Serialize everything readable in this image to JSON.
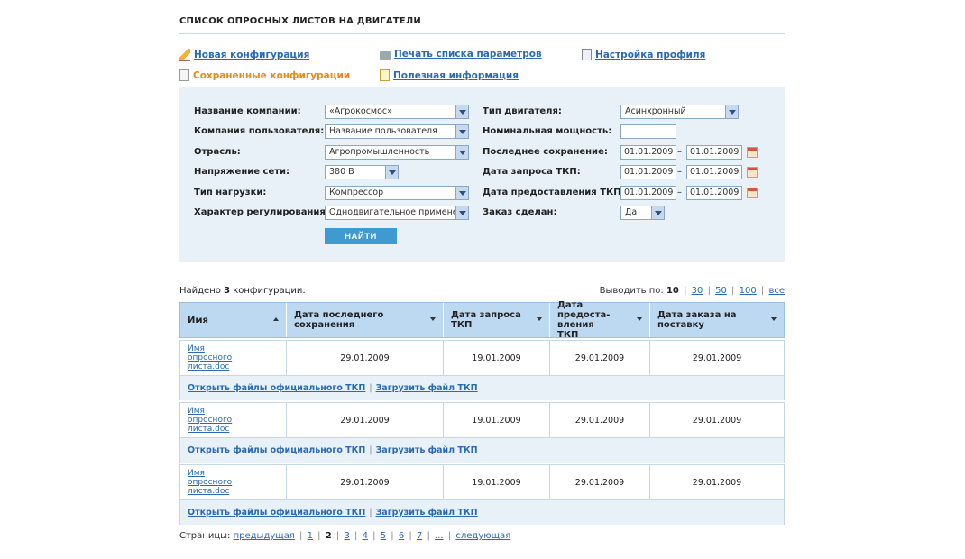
{
  "page_title": "СПИСОК ОПРОСНЫХ ЛИСТОВ НА ДВИГАТЕЛИ",
  "nav": {
    "new_config": "Новая конфигурация",
    "print_params": "Печать списка параметров",
    "profile_settings": "Настройка профиля",
    "saved_configs": "Сохраненные конфигурации",
    "useful_info": "Полезная информация"
  },
  "filters": {
    "company_name_label": "Название компании:",
    "company_name_value": "«Агрокосмос»",
    "user_company_label": "Компания пользователя:",
    "user_company_value": "Название пользователя",
    "industry_label": "Отрасль:",
    "industry_value": "Агропромышленность",
    "voltage_label": "Напряжение сети:",
    "voltage_value": "380 В",
    "load_type_label": "Тип нагрузки:",
    "load_type_value": "Компрессор",
    "regulation_label": "Характер регулирования:",
    "regulation_value": "Однодвигательное применен",
    "engine_type_label": "Тип двигателя:",
    "engine_type_value": "Асинхронный",
    "rated_power_label": "Номинальная мощность:",
    "rated_power_value": "",
    "last_save_label": "Последнее сохранение:",
    "last_save_from": "01.01.2009",
    "last_save_to": "01.01.2009",
    "tkp_request_label": "Дата запроса ТКП:",
    "tkp_request_from": "01.01.2009",
    "tkp_request_to": "01.01.2009",
    "tkp_provide_label": "Дата предоставления ТКП:",
    "tkp_provide_from": "01.01.2009",
    "tkp_provide_to": "01.01.2009",
    "order_made_label": "Заказ сделан:",
    "order_made_value": "Да",
    "dash": "–",
    "search_button": "НАЙТИ"
  },
  "results": {
    "found_prefix": "Найдено",
    "found_count": "3",
    "found_suffix": "конфигурации:",
    "per_page_label": "Выводить по:",
    "per_page_current": "10",
    "per_page_options": [
      "30",
      "50",
      "100",
      "все"
    ]
  },
  "table": {
    "headers": {
      "name": "Имя",
      "last_saved": "Дата последнего сохранения",
      "tkp_request": "Дата запроса ТКП",
      "tkp_provided": "Дата предоста-вления ТКП",
      "order_date": "Дата заказа на поставку"
    },
    "rows": [
      {
        "name": "Имя опросного листа.doc",
        "last_saved": "29.01.2009",
        "tkp_request": "19.01.2009",
        "tkp_provided": "29.01.2009",
        "order_date": "29.01.2009",
        "open_link": "Открыть файлы официального ТКП",
        "upload_link": "Загрузить файл ТКП"
      },
      {
        "name": "Имя опросного листа.doc",
        "last_saved": "29.01.2009",
        "tkp_request": "19.01.2009",
        "tkp_provided": "29.01.2009",
        "order_date": "29.01.2009",
        "open_link": "Открыть файлы официального ТКП",
        "upload_link": "Загрузить файл ТКП"
      },
      {
        "name": "Имя опросного листа.doc",
        "last_saved": "29.01.2009",
        "tkp_request": "19.01.2009",
        "tkp_provided": "29.01.2009",
        "order_date": "29.01.2009",
        "open_link": "Открыть файлы официального ТКП",
        "upload_link": "Загрузить файл ТКП"
      }
    ]
  },
  "pager": {
    "label": "Страницы:",
    "prev": "предыдущая",
    "pages": [
      "1",
      "2",
      "3",
      "4",
      "5",
      "6",
      "7",
      "..."
    ],
    "current": "2",
    "next": "следующая"
  }
}
